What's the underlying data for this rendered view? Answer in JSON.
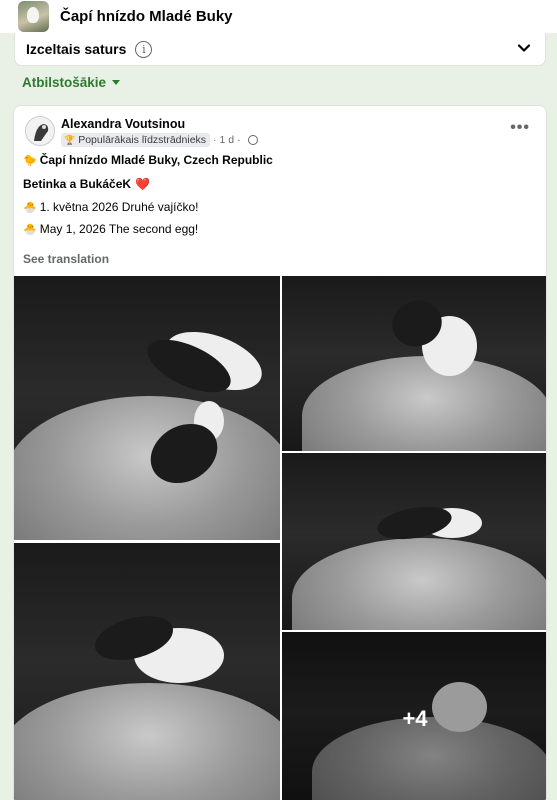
{
  "header": {
    "group_name": "Čapí hnízdo Mladé Buky"
  },
  "featured": {
    "label": "Izceltais saturs",
    "info_icon": "i"
  },
  "sort": {
    "label": "Atbilstošākie"
  },
  "post": {
    "author": "Alexandra Voutsinou",
    "badge": "Populārākais līdzstrādnieks",
    "time": "1 d",
    "more": "•••",
    "line1_emoji": "🐤",
    "line1": "Čapí hnízdo Mladé Buky, Czech Republic",
    "line2": "Betinka a BukáčeK",
    "line2_emoji": "❤️",
    "line3_emoji": "🐣",
    "line3": "1. května 2026 Druhé vajíčko!",
    "line4_emoji": "🐣",
    "line4": "May 1, 2026 The second egg!",
    "see_translation": "See translation",
    "more_photos": "+4"
  }
}
